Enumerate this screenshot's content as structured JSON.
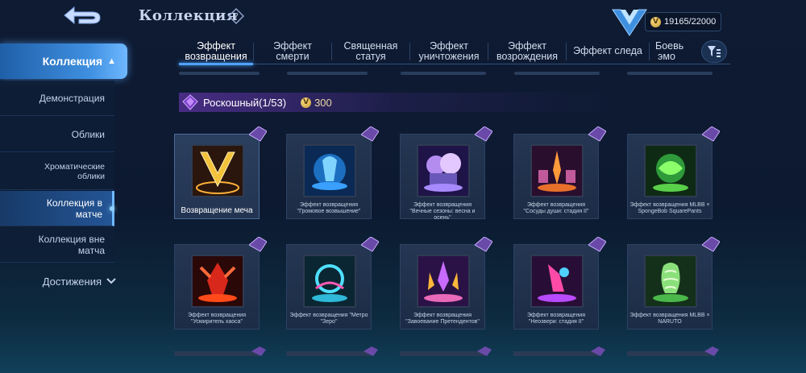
{
  "header": {
    "title": "Коллекция",
    "help_icon": "question-icon",
    "back_icon": "back-arrow-icon",
    "currency": {
      "icon": "coin-icon",
      "symbol": "V",
      "value": "19165/22000"
    },
    "rank_icon": "rank-emblem-icon"
  },
  "sidebar": {
    "main": {
      "label": "Коллекция",
      "chevron": "^"
    },
    "items": [
      {
        "label": "Демонстрация"
      },
      {
        "label": "Облики"
      },
      {
        "label": "Хроматические облики"
      },
      {
        "label": "Коллекция в матче",
        "active": true
      },
      {
        "label": "Коллекция вне матча"
      }
    ],
    "achievements": {
      "label": "Достижения"
    }
  },
  "tabs": [
    {
      "label": "Эффект возвращения",
      "active": true
    },
    {
      "label": "Эффект смерти"
    },
    {
      "label": "Священная статуя"
    },
    {
      "label": "Эффект уничтожения"
    },
    {
      "label": "Эффект возрождения"
    },
    {
      "label": "Эффект следа"
    },
    {
      "label": "Боевые эмо"
    }
  ],
  "filter_icon": "filter-sort-icon",
  "section": {
    "title": "Роскошный(1/53)",
    "price": "300",
    "icon": "diamond-gem-icon",
    "colors": {
      "accent": "#8a4fd6",
      "price": "#e8d8a0"
    }
  },
  "cards": [
    {
      "label": "Возвращение меча",
      "selected": true,
      "art": "sword"
    },
    {
      "label": "Эффект возвращения \"Громовое возвышение\"",
      "art": "thunder"
    },
    {
      "label": "Эффект возвращения \"Вечные сезоны: весна и осень\"",
      "art": "seasons"
    },
    {
      "label": "Эффект возвращения \"Сосуды души: стадия II\"",
      "art": "soul"
    },
    {
      "label": "Эффект возвращения MLBB × SpongeBob SquarePants",
      "art": "sponge"
    },
    {
      "label": "Эффект возвращения \"Усмиритель хаоса\"",
      "art": "chaos"
    },
    {
      "label": "Эффект возвращения \"Метро \"Зеро\"",
      "art": "metro"
    },
    {
      "label": "Эффект возвращения \"Завоевание Претендентов\"",
      "art": "conquest"
    },
    {
      "label": "Эффект возвращения \"Неозвери: стадия II\"",
      "art": "neobeast"
    },
    {
      "label": "Эффект возвращения MLBB × NARUTO",
      "art": "naruto"
    }
  ],
  "colors": {
    "background": "#0f1b33",
    "active_tab": "#4fa3ff",
    "sidebar_active": "#3f8fe0"
  }
}
